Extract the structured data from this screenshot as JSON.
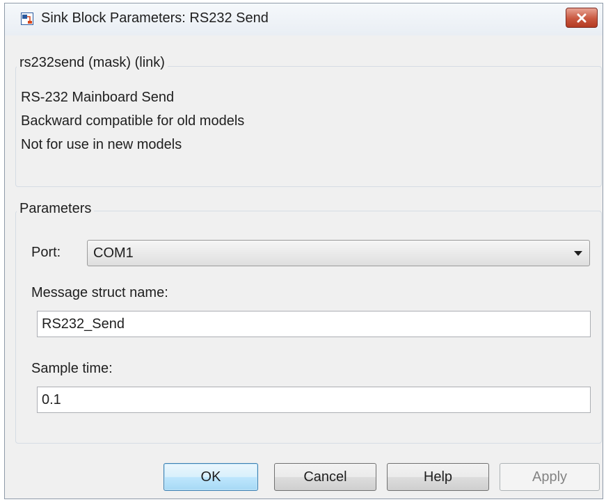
{
  "window": {
    "title": "Sink Block Parameters: RS232 Send",
    "close_icon": "close-icon"
  },
  "description": {
    "legend": "rs232send (mask) (link)",
    "lines": [
      "RS-232 Mainboard Send",
      "Backward compatible for old models",
      "Not for use in new models"
    ]
  },
  "parameters": {
    "legend": "Parameters",
    "port_label": "Port:",
    "port_value": "COM1",
    "message_label": "Message struct name:",
    "message_value": "RS232_Send",
    "sample_label": "Sample time:",
    "sample_value": "0.1"
  },
  "buttons": {
    "ok": "OK",
    "cancel": "Cancel",
    "help": "Help",
    "apply": "Apply"
  },
  "colors": {
    "close_button": "#c9573f",
    "default_button_border": "#3c7fb1"
  }
}
